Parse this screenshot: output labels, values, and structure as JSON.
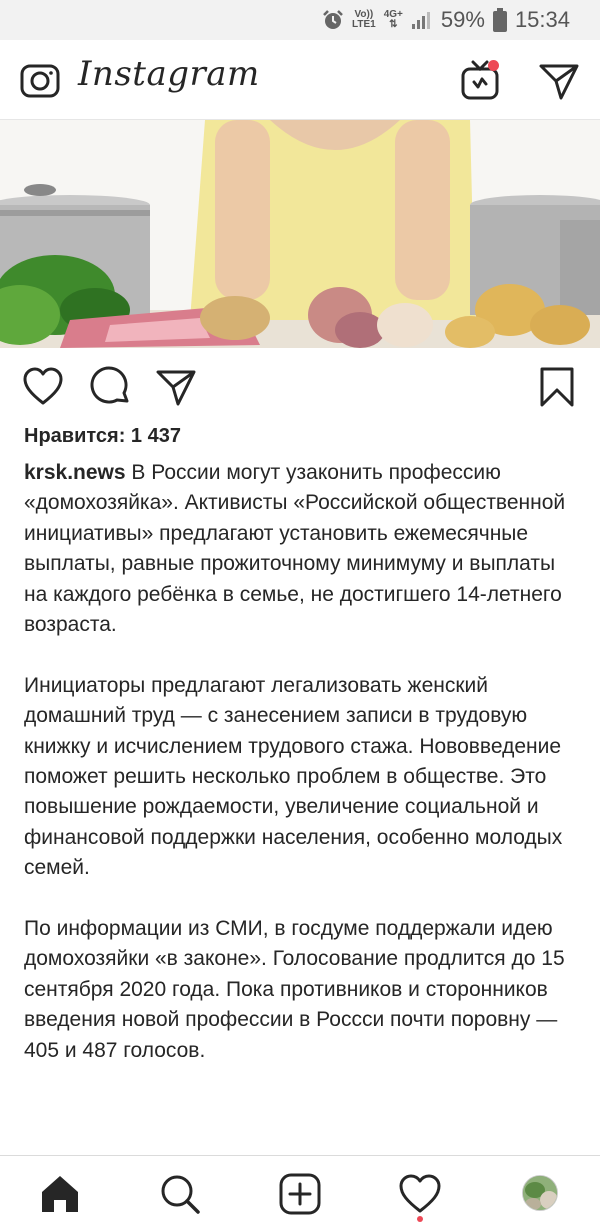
{
  "status_bar": {
    "volte_line1": "Vo))",
    "volte_line2": "LTE1",
    "network_top": "4G+",
    "battery_percent": "59%",
    "time": "15:34"
  },
  "header": {
    "logo_text": "Instagram",
    "icons": [
      "camera-icon",
      "igtv-icon",
      "direct-message-icon"
    ]
  },
  "post": {
    "likes_text": "Нравится: 1 437",
    "username": "krsk.news",
    "caption_paragraphs": [
      "В России могут узаконить профессию «домохозяйка». Активисты «Российской общественной инициативы» предлагают установить ежемесячные выплаты, равные прожиточному минимуму и выплаты на каждого ребёнка в семье, не достигшего 14-летнего возраста.",
      "Инициаторы предлагают легализовать женский домашний труд — с занесением записи в трудовую книжку и исчислением трудового стажа. Нововведение поможет решить несколько проблем в обществе. Это повышение рождаемости, увеличение социальной и финансовой поддержки населения, особенно молодых семей.",
      "По информации из СМИ, в госдуме поддержали идею домохозяйки «в законе». Голосование продлится до 15 сентября 2020 года. Пока противников и сторонников введения новой профессии в Россси почти поровну — 405 и 487 голосов."
    ],
    "action_icons": [
      "heart-icon",
      "comment-icon",
      "share-icon",
      "bookmark-icon"
    ]
  },
  "bottom_nav": {
    "items": [
      "home-icon",
      "search-icon",
      "add-post-icon",
      "activity-heart-icon",
      "profile-avatar"
    ]
  },
  "colors": {
    "text": "#262626",
    "notification_dot": "#ed4956",
    "border": "#dbdbdb"
  }
}
